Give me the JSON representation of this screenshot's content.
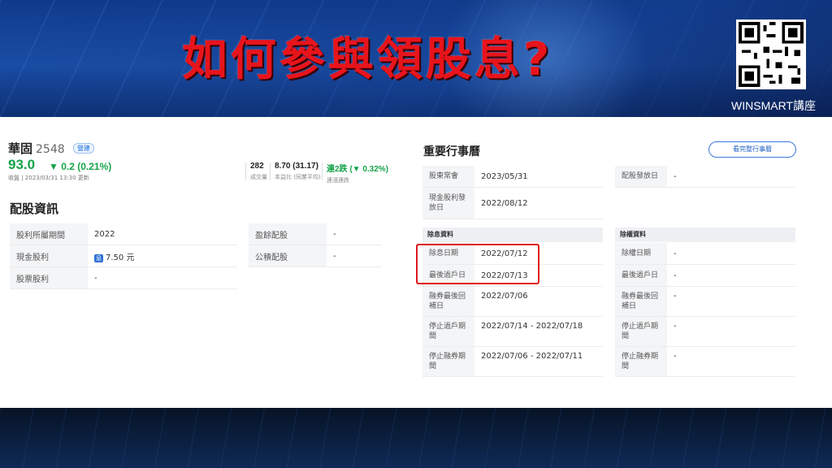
{
  "banner": {
    "title": "如何參與領股息?",
    "brand": "WINSMART講座"
  },
  "colors": {
    "title_red": "#e8141c",
    "price_green": "#16a34a",
    "highlight": "#e0161c",
    "link_blue": "#1e5fc4"
  },
  "stock": {
    "name": "華固",
    "code": "2548",
    "tag": "營建",
    "price": "93.0",
    "change": "▼ 0.2 (0.21%)",
    "close_meta": "收盤 | 2023/03/31 13:30 更新",
    "stats": [
      {
        "value": "282",
        "label": "成交量"
      },
      {
        "value": "8.70 (31.17)",
        "label": "本益比 (同業平均)"
      },
      {
        "value": "連2跌 (▼ 0.32%)",
        "label": "連漲連跌"
      }
    ]
  },
  "dividend": {
    "title": "配股資訊",
    "left_rows": [
      {
        "key": "股利所屬期間",
        "value": "2022"
      },
      {
        "key": "現金股利",
        "value": "7.50 元",
        "badge": "息"
      },
      {
        "key": "股票股利",
        "value": "-"
      }
    ],
    "right_rows": [
      {
        "key": "盈餘配股",
        "value": "-"
      },
      {
        "key": "公積配股",
        "value": "-"
      }
    ]
  },
  "calendar": {
    "title": "重要行事曆",
    "button": "看完整行事曆",
    "top_left": [
      {
        "key": "股東常會",
        "value": "2023/05/31"
      },
      {
        "key": "現金股利發放日",
        "value": "2022/08/12"
      }
    ],
    "top_right": [
      {
        "key": "配股發放日",
        "value": "-"
      }
    ],
    "ex_div_title": "除息資料",
    "ex_div": [
      {
        "key": "除息日期",
        "value": "2022/07/12"
      },
      {
        "key": "最後過戶日",
        "value": "2022/07/13"
      },
      {
        "key": "融券最後回補日",
        "value": "2022/07/06"
      },
      {
        "key": "停止過戶期間",
        "value": "2022/07/14 - 2022/07/18"
      },
      {
        "key": "停止融券期間",
        "value": "2022/07/06 - 2022/07/11"
      }
    ],
    "ex_right_title": "除權資料",
    "ex_right": [
      {
        "key": "除權日期",
        "value": "-"
      },
      {
        "key": "最後過戶日",
        "value": "-"
      },
      {
        "key": "融券最後回補日",
        "value": "-"
      },
      {
        "key": "停止過戶期間",
        "value": "-"
      },
      {
        "key": "停止融券期間",
        "value": "-"
      }
    ]
  }
}
